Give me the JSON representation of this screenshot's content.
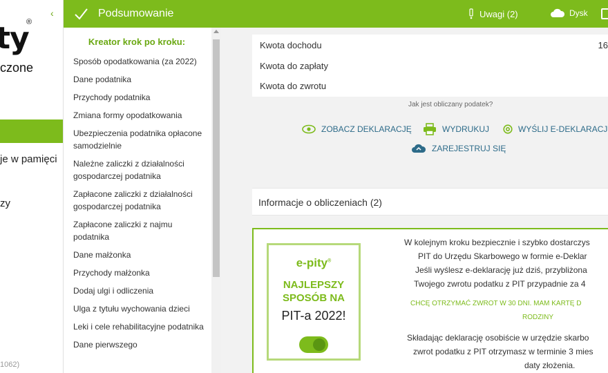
{
  "brand": {
    "logo_text": "ty",
    "reg_mark": "®",
    "subtitle": "czone",
    "collapse_glyph": "‹",
    "memory_text": "je w pamięci",
    "zy_text": "zy",
    "version_text": "1062)"
  },
  "topbar": {
    "title": "Podsumowanie",
    "uwagi_label": "Uwagi (2)",
    "dysk_label": "Dysk",
    "bg_color": "#7dbb1c"
  },
  "wizard": {
    "heading": "Kreator krok po kroku:",
    "items": [
      "Sposób opodatkowania (za 2022)",
      "Dane podatnika",
      "Przychody podatnika",
      "Zmiana formy opodatkowania",
      "Ubezpieczenia podatnika opłacone samodzielnie",
      "Należne zaliczki z działalności gospodarczej podatnika",
      "Zapłacone zaliczki z działalności gospodarczej podatnika",
      "Zapłacone zaliczki z najmu podatnika",
      "Dane małżonka",
      "Przychody małżonka",
      "Dodaj ulgi i odliczenia",
      "Ulga z tytułu wychowania dzieci",
      "Leki i cele rehabilitacyjne podatnika",
      "Dane pierwszego"
    ]
  },
  "summary": {
    "rows": [
      {
        "label": "Kwota dochodu",
        "value": "16"
      },
      {
        "label": "Kwota do zapłaty",
        "value": ""
      },
      {
        "label": "Kwota do zwrotu",
        "value": ""
      }
    ],
    "how_calculated": "Jak jest obliczany podatek?"
  },
  "actions": {
    "view": "ZOBACZ DEKLARACJĘ",
    "print": "WYDRUKUJ",
    "send": "WYŚLIJ E-DEKLARACJĘ",
    "register": "ZAREJESTRUJ SIĘ"
  },
  "info": {
    "label": "Informacje o obliczeniach (2)"
  },
  "promo": {
    "badge_logo": "e-pity",
    "badge_reg": "®",
    "badge_best_line1": "NAJLEPSZY",
    "badge_best_line2": "SPOSÓB NA",
    "badge_pit": "PIT-a 2022!",
    "line1": "W kolejnym kroku bezpiecznie i szybko dostarczys",
    "line2": "PIT do Urzędu Skarbowego w formie e-Deklar",
    "line3": "Jeśli wyślesz e-deklarację już dziś, przybliżona",
    "line4": "Twojego zwrotu podatku z PIT przypadnie za 4",
    "green1": "CHCĘ OTRZYMAĆ ZWROT W 30 DNI. MAM KARTĘ D",
    "green2": "RODZINY",
    "line5": "Składając deklarację osobiście w urzędzie skarbo",
    "line6": "zwrot podatku z PIT otrzymasz w terminie 3 mies",
    "line7": "daty złożenia."
  },
  "colors": {
    "accent_green": "#7dbb1c",
    "link_blue": "#2d6b89"
  }
}
